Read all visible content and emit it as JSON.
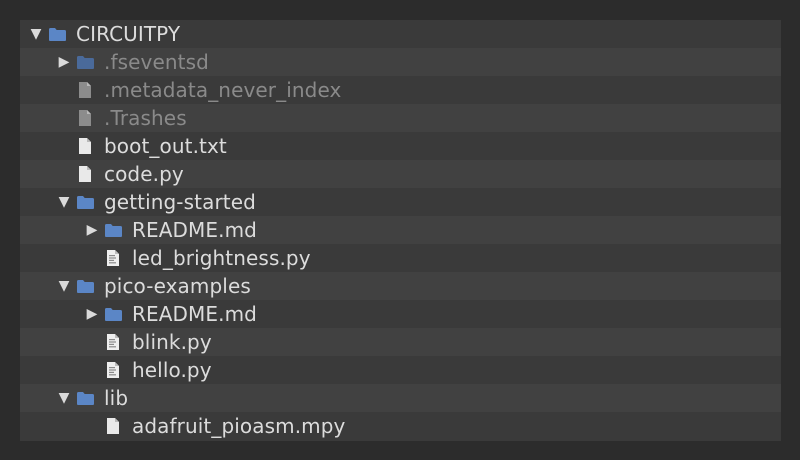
{
  "colors": {
    "folder": "#5b86c6",
    "file": "#e9e9e9",
    "hidden_file": "#8c8c8c",
    "text": "#dcdcdc",
    "hidden_text": "#8a8a8a"
  },
  "tree": {
    "items": [
      {
        "label": "CIRCUITPY",
        "depth": 0,
        "kind": "folder",
        "expanded": true,
        "hidden": false
      },
      {
        "label": ".fseventsd",
        "depth": 1,
        "kind": "folder",
        "expanded": false,
        "hidden": true
      },
      {
        "label": ".metadata_never_index",
        "depth": 1,
        "kind": "file",
        "hidden": true
      },
      {
        "label": ".Trashes",
        "depth": 1,
        "kind": "file",
        "hidden": true
      },
      {
        "label": "boot_out.txt",
        "depth": 1,
        "kind": "file",
        "hidden": false
      },
      {
        "label": "code.py",
        "depth": 1,
        "kind": "file",
        "hidden": false
      },
      {
        "label": "getting-started",
        "depth": 1,
        "kind": "folder",
        "expanded": true,
        "hidden": false
      },
      {
        "label": "README.md",
        "depth": 2,
        "kind": "folder",
        "expanded": false,
        "hidden": false
      },
      {
        "label": "led_brightness.py",
        "depth": 2,
        "kind": "script",
        "hidden": false
      },
      {
        "label": "pico-examples",
        "depth": 1,
        "kind": "folder",
        "expanded": true,
        "hidden": false
      },
      {
        "label": "README.md",
        "depth": 2,
        "kind": "folder",
        "expanded": false,
        "hidden": false
      },
      {
        "label": "blink.py",
        "depth": 2,
        "kind": "script",
        "hidden": false
      },
      {
        "label": "hello.py",
        "depth": 2,
        "kind": "script",
        "hidden": false
      },
      {
        "label": "lib",
        "depth": 1,
        "kind": "folder",
        "expanded": true,
        "hidden": false
      },
      {
        "label": "adafruit_pioasm.mpy",
        "depth": 2,
        "kind": "file",
        "hidden": false
      }
    ]
  }
}
